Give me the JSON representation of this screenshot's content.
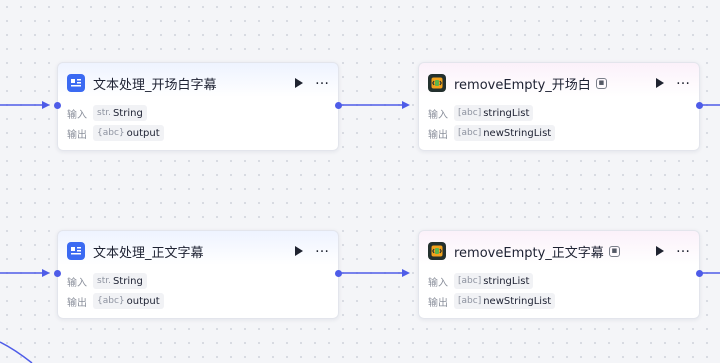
{
  "canvas": {
    "edge_color": "#4e5ce8"
  },
  "nodes": [
    {
      "id": "text1",
      "title": "文本处理_开场白字幕",
      "input_label": "输入",
      "input_type": "str.",
      "input_name": "String",
      "output_label": "输出",
      "output_type": "{abc}",
      "output_name": "output"
    },
    {
      "id": "code1",
      "title": "removeEmpty_开场白",
      "input_label": "输入",
      "input_type": "[abc]",
      "input_name": "stringList",
      "output_label": "输出",
      "output_type": "[abc]",
      "output_name": "newStringList"
    },
    {
      "id": "text2",
      "title": "文本处理_正文字幕",
      "input_label": "输入",
      "input_type": "str.",
      "input_name": "String",
      "output_label": "输出",
      "output_type": "{abc}",
      "output_name": "output"
    },
    {
      "id": "code2",
      "title": "removeEmpty_正文字幕",
      "input_label": "输入",
      "input_type": "[abc]",
      "input_name": "stringList",
      "output_label": "输出",
      "output_type": "[abc]",
      "output_name": "newStringList"
    }
  ],
  "icons": {
    "text_node_icon": "text-processing-icon",
    "code_node_icon": "code-icon",
    "run_icon": "play-icon",
    "more_icon": "more-icon",
    "code_badge": "robot-icon"
  }
}
